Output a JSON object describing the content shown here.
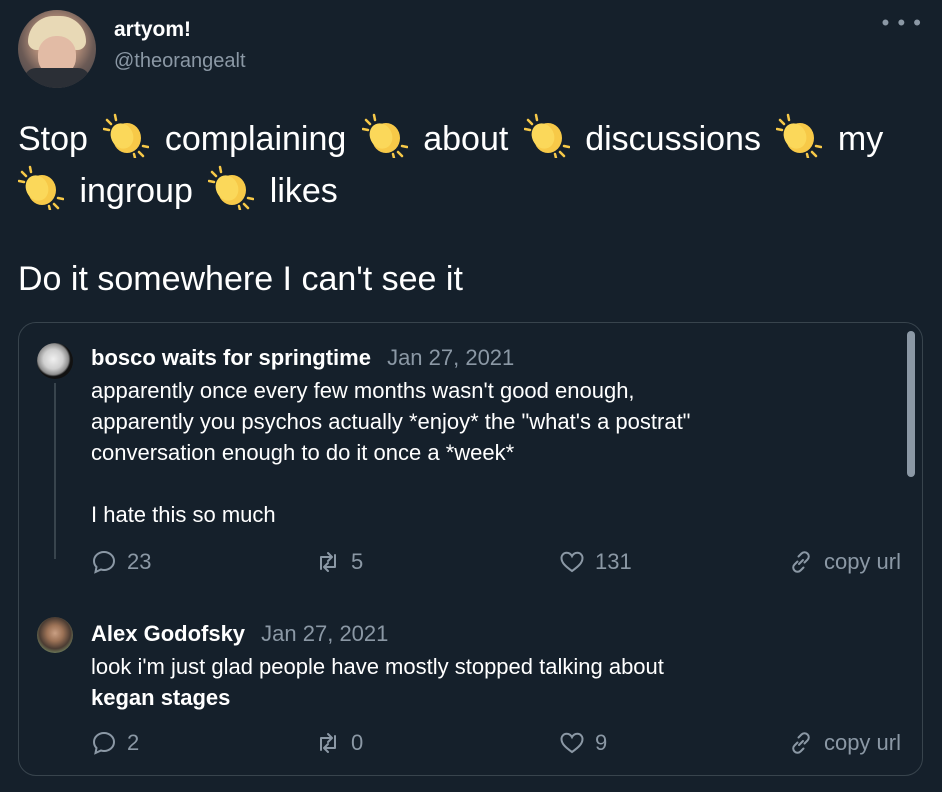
{
  "author": {
    "display_name": "artyom!",
    "handle": "@theorangealt"
  },
  "tweet": {
    "line1_words": [
      "Stop",
      "complaining",
      "about",
      "discussions",
      "my"
    ],
    "line2_words": [
      "ingroup",
      "likes"
    ],
    "line3": "Do it somewhere I can't see it",
    "emoji": "clapping-hands"
  },
  "thread": {
    "posts": [
      {
        "author": "bosco waits for springtime",
        "date": "Jan 27, 2021",
        "body_lines": [
          "apparently once every few months wasn't good enough,",
          "apparently you psychos actually *enjoy* the \"what's a postrat\"",
          "conversation enough to do it once a *week*",
          "",
          "I hate this so much"
        ],
        "replies": "23",
        "retweets": "5",
        "likes": "131",
        "copy_label": "copy url"
      },
      {
        "author": "Alex Godofsky",
        "date": "Jan 27, 2021",
        "body_line1": "look i'm just glad people have mostly stopped talking about",
        "body_bold": "kegan stages",
        "replies": "2",
        "retweets": "0",
        "likes": "9",
        "copy_label": "copy url"
      }
    ]
  },
  "colors": {
    "background": "#15202b",
    "muted": "#8b98a5",
    "border": "#38444d",
    "clap": "#f7c948"
  }
}
